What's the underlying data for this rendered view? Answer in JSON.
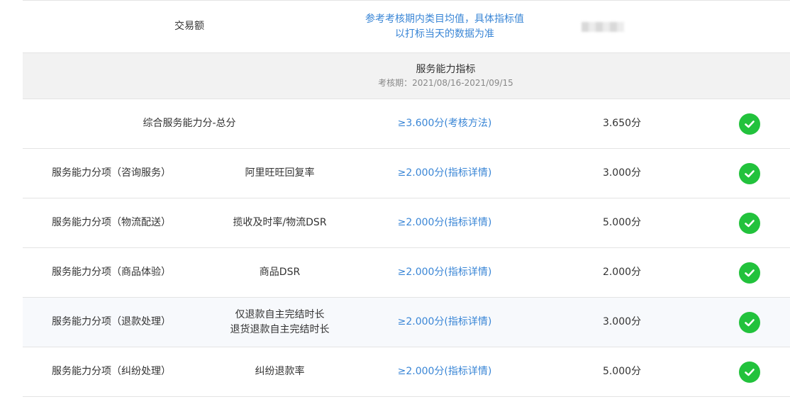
{
  "top_row": {
    "label": "交易额",
    "standard_lines": [
      "参考考核期内类目均值，具体指标值",
      "以打标当天的数据为准"
    ]
  },
  "section": {
    "title": "服务能力指标",
    "period": "考核期：2021/08/16-2021/09/15"
  },
  "rows": [
    {
      "category": "综合服务能力分-总分",
      "metric": "",
      "standard": "≥3.600分(考核方法)",
      "value": "3.650分",
      "status": "passed"
    },
    {
      "category": "服务能力分项（咨询服务）",
      "metric": "阿里旺旺回复率",
      "standard": "≥2.000分(指标详情)",
      "value": "3.000分",
      "status": "passed"
    },
    {
      "category": "服务能力分项（物流配送）",
      "metric": "揽收及时率/物流DSR",
      "standard": "≥2.000分(指标详情)",
      "value": "5.000分",
      "status": "passed"
    },
    {
      "category": "服务能力分项（商品体验）",
      "metric": "商品DSR",
      "standard": "≥2.000分(指标详情)",
      "value": "2.000分",
      "status": "passed"
    },
    {
      "category": "服务能力分项（退款处理）",
      "metric_lines": [
        "仅退款自主完结时长",
        "退货退款自主完结时长"
      ],
      "standard": "≥2.000分(指标详情)",
      "value": "3.000分",
      "status": "passed"
    },
    {
      "category": "服务能力分项（纠纷处理）",
      "metric": "纠纷退款率",
      "standard": "≥2.000分(指标详情)",
      "value": "5.000分",
      "status": "passed"
    }
  ],
  "colors": {
    "link": "#3a86d6",
    "pass": "#22c23c",
    "section_bg": "#f2f2f2"
  },
  "icons": {
    "status": "check-circle-icon"
  }
}
